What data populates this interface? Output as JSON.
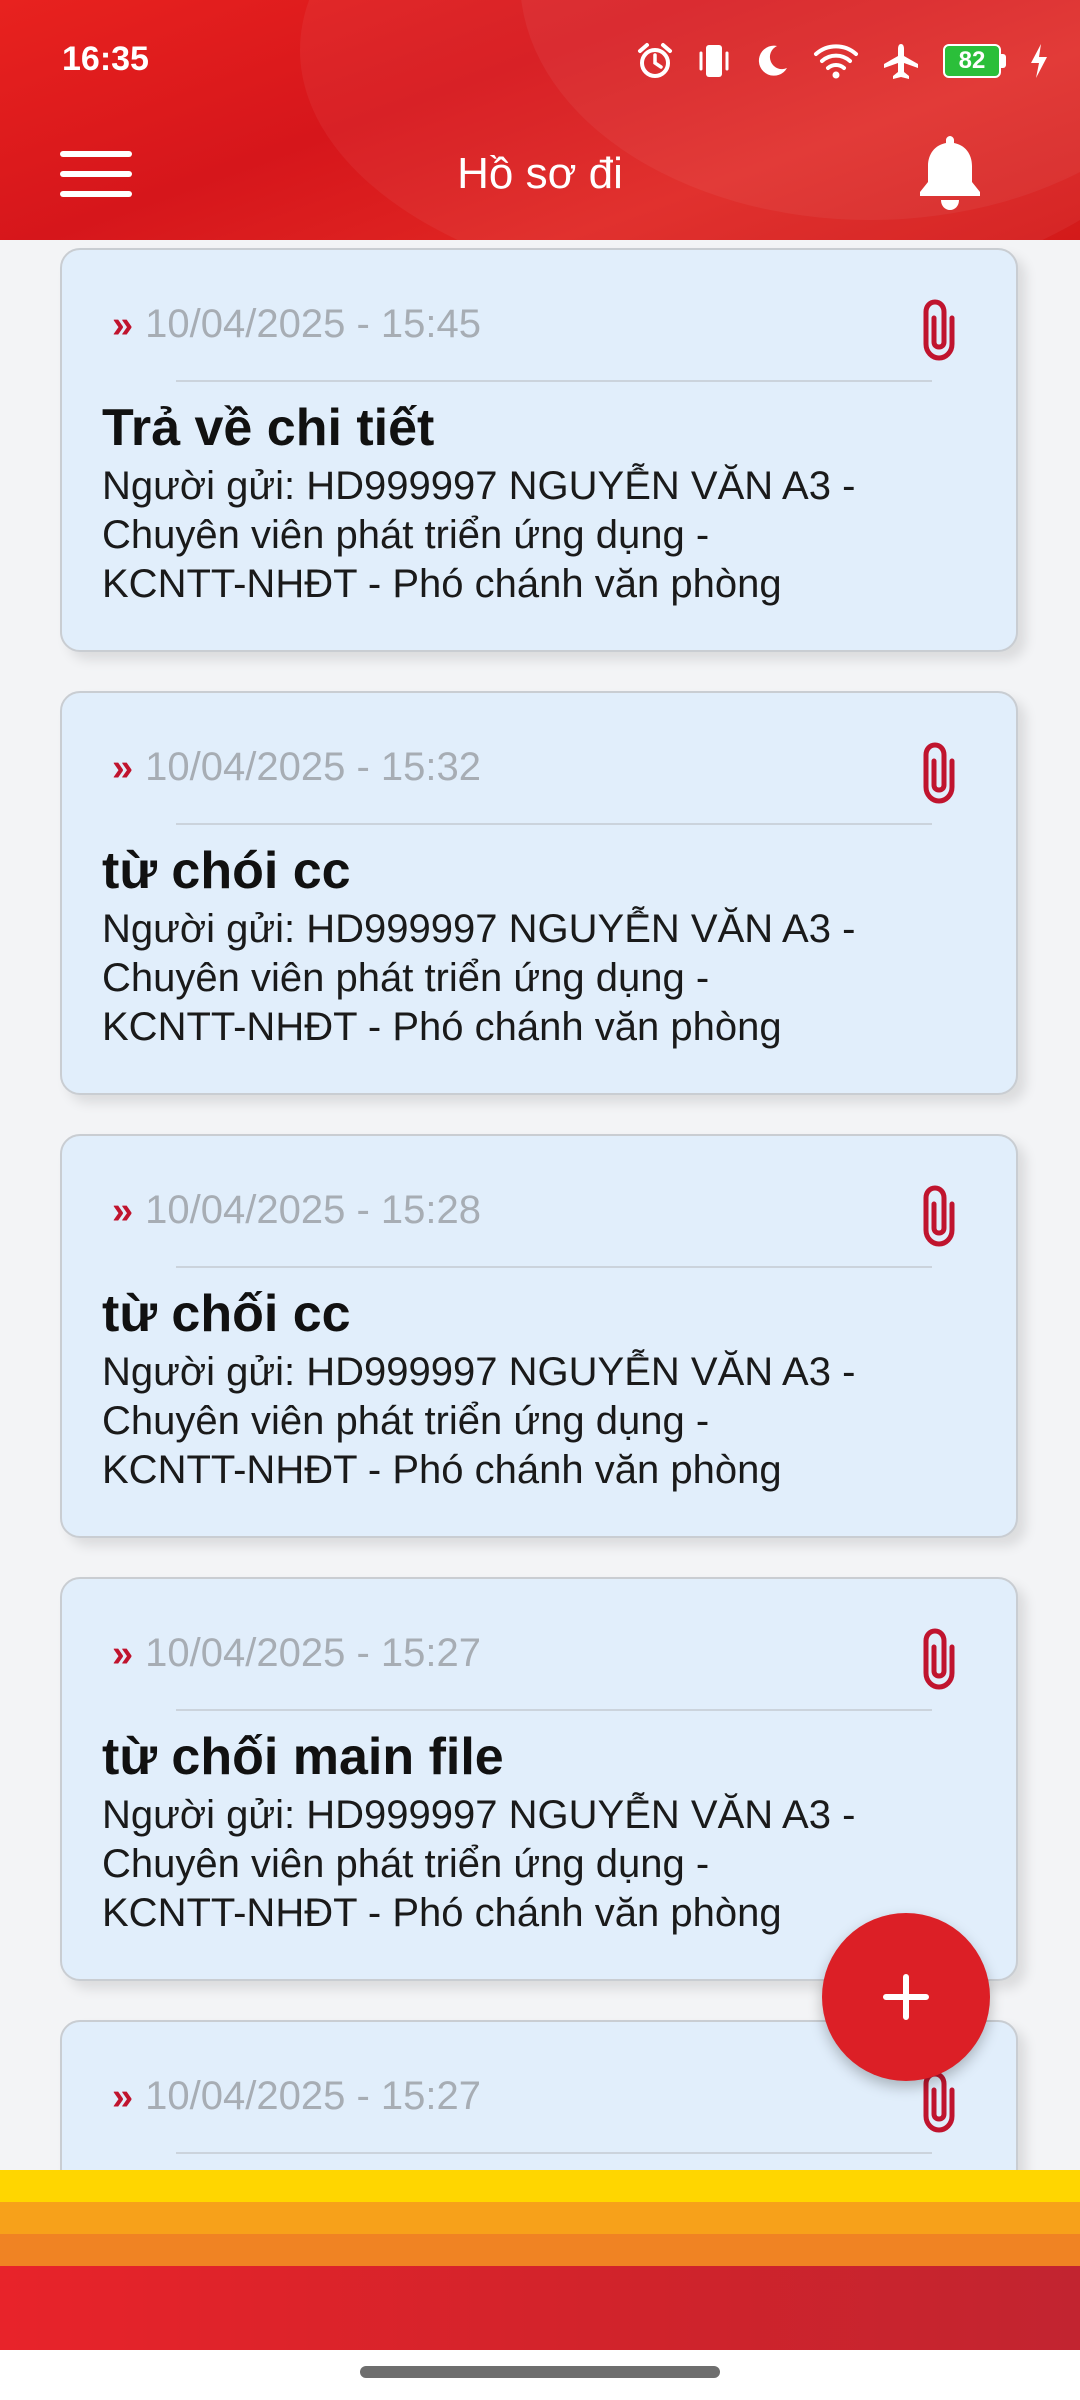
{
  "status_bar": {
    "time": "16:35",
    "battery": "82",
    "icons": [
      "alarm-icon",
      "vibrate-icon",
      "moon-icon",
      "wifi-icon",
      "airplane-icon",
      "battery-icon",
      "charging-icon"
    ]
  },
  "header": {
    "title": "Hồ sơ đi",
    "menu_icon": "hamburger-menu-icon",
    "notification_icon": "bell-icon"
  },
  "cards": [
    {
      "date": "10/04/2025 - 15:45",
      "title": "Trả về chi tiết",
      "sender": "Người gửi: HD999997 NGUYỄN VĂN A3 - Chuyên viên phát triển ứng dụng - KCNTT-NHĐT - Phó chánh văn phòng"
    },
    {
      "date": "10/04/2025 - 15:32",
      "title": "từ chói cc",
      "sender": "Người gửi: HD999997 NGUYỄN VĂN A3 - Chuyên viên phát triển ứng dụng - KCNTT-NHĐT - Phó chánh văn phòng"
    },
    {
      "date": "10/04/2025 - 15:28",
      "title": "từ chối cc",
      "sender": "Người gửi: HD999997 NGUYỄN VĂN A3 - Chuyên viên phát triển ứng dụng - KCNTT-NHĐT - Phó chánh văn phòng"
    },
    {
      "date": "10/04/2025 - 15:27",
      "title": "từ chối main file",
      "sender": "Người gửi: HD999997 NGUYỄN VĂN A3 - Chuyên viên phát triển ứng dụng - KCNTT-NHĐT - Phó chánh văn phòng"
    },
    {
      "date": "10/04/2025 - 15:27",
      "title": "",
      "sender": ""
    }
  ],
  "colors": {
    "header_red": "#e0201f",
    "card_bg": "#e1eefb",
    "accent_red": "#c0142e",
    "fab_red": "#dc1f26",
    "band_yellow": "#ffd600",
    "band_orange": "#f7a11a",
    "band_red": "#e8232a"
  },
  "fab": {
    "icon": "plus-icon"
  }
}
